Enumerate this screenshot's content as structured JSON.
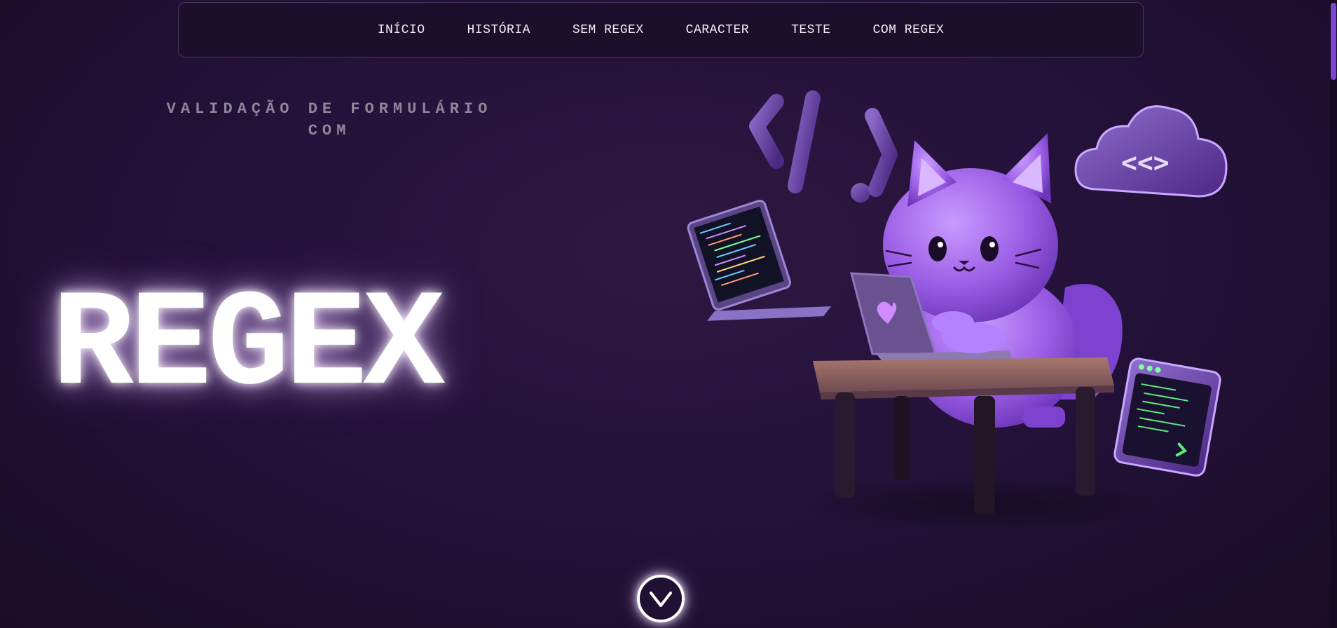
{
  "nav": {
    "items": [
      {
        "label": "INÍCIO"
      },
      {
        "label": "HISTÓRIA"
      },
      {
        "label": "SEM REGEX"
      },
      {
        "label": "CARACTER"
      },
      {
        "label": "TESTE"
      },
      {
        "label": "COM REGEX"
      }
    ]
  },
  "hero": {
    "subtitle_line1": "VALIDAÇÃO DE FORMULÁRIO",
    "subtitle_line2": "COM",
    "title": "REGEX"
  },
  "illustration": {
    "description_icon": "cat-at-laptop-illustration",
    "code_symbol": "</>",
    "cloud_symbol": "<<>"
  },
  "scroll": {
    "icon": "chevron-down-icon"
  },
  "colors": {
    "background": "#24123a",
    "accent": "#9b5de5",
    "nav_border": "#4a3560"
  }
}
